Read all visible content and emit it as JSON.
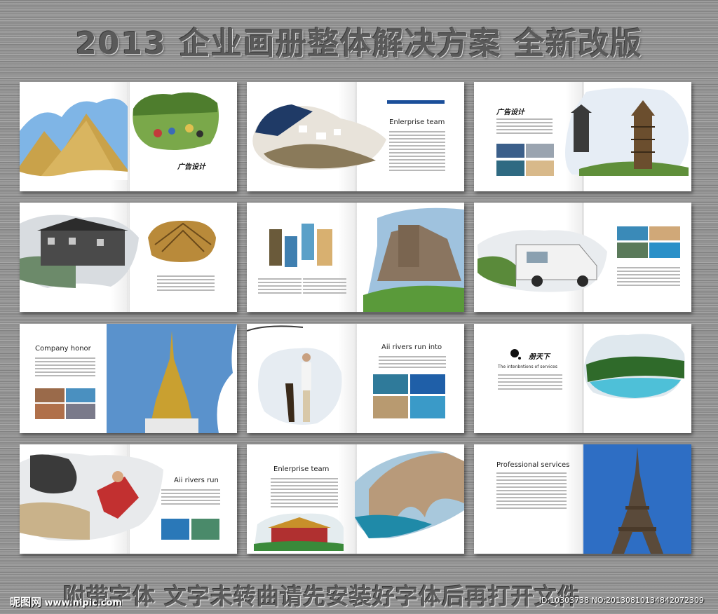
{
  "header": {
    "title": "2013 企业画册整体解决方案   全新改版"
  },
  "footer": {
    "note": "附带字体 文字未转曲请先安装好字体后再打开文件"
  },
  "watermark": {
    "site_brand": "昵图网",
    "site_url": "www.nipic.com",
    "id_text": "ID:10303738 NO:20130810134842072309"
  },
  "spreads": [
    {
      "id": "s1",
      "signature": "广告设计"
    },
    {
      "id": "s2",
      "title": "Enlerprise team"
    },
    {
      "id": "s3",
      "signature": "广告设计"
    },
    {
      "id": "s4"
    },
    {
      "id": "s5"
    },
    {
      "id": "s6"
    },
    {
      "id": "s7",
      "title": "Company honor"
    },
    {
      "id": "s8",
      "title": "Aii rivers run into"
    },
    {
      "id": "s9",
      "signature": "册天下",
      "subtitle": "The intenbntions of services"
    },
    {
      "id": "s10",
      "title": "Aii rivers run"
    },
    {
      "id": "s11",
      "title": "Enlerprise team"
    },
    {
      "id": "s12",
      "title": "Professional services"
    }
  ],
  "colors": {
    "accent_blue": "#1b4f9a",
    "sky": "#7db3e0",
    "grass": "#6aa33b"
  }
}
